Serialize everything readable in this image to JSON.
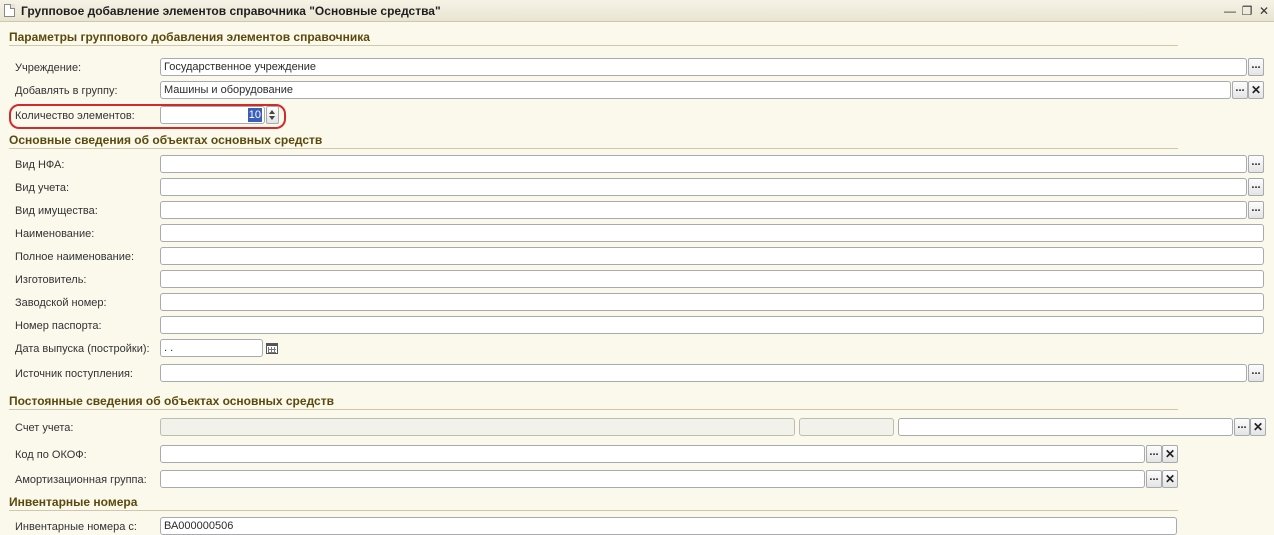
{
  "window": {
    "title": "Групповое добавление элементов справочника \"Основные средства\"",
    "minimize_icon": "minimize-icon",
    "restore_icon": "restore-icon",
    "close_icon": "close-icon"
  },
  "sections": {
    "group_params": "Параметры группового добавления элементов справочника",
    "basic_info": "Основные сведения об объектах основных средств",
    "constant_info": "Постоянные сведения об объектах основных средств",
    "inventory": "Инвентарные номера"
  },
  "fields": {
    "institution": {
      "label": "Учреждение:",
      "value": "Государственное учреждение"
    },
    "add_to_group": {
      "label": "Добавлять в группу:",
      "value": "Машины и оборудование"
    },
    "count": {
      "label": "Количество элементов:",
      "value": "10"
    },
    "nfa_type": {
      "label": "Вид НФА:",
      "value": ""
    },
    "accounting_type": {
      "label": "Вид учета:",
      "value": ""
    },
    "property_type": {
      "label": "Вид имущества:",
      "value": ""
    },
    "name": {
      "label": "Наименование:",
      "value": ""
    },
    "full_name": {
      "label": "Полное наименование:",
      "value": ""
    },
    "manufacturer": {
      "label": "Изготовитель:",
      "value": ""
    },
    "serial_number": {
      "label": "Заводской номер:",
      "value": ""
    },
    "passport_number": {
      "label": "Номер паспорта:",
      "value": ""
    },
    "release_date": {
      "label": "Дата выпуска (постройки):",
      "value": " .  ."
    },
    "source": {
      "label": "Источник поступления:",
      "value": ""
    },
    "account": {
      "label": "Счет учета:",
      "value": ""
    },
    "okof": {
      "label": "Код по ОКОФ:",
      "value": ""
    },
    "depreciation_group": {
      "label": "Амортизационная группа:",
      "value": ""
    },
    "inventory_from": {
      "label": "Инвентарные номера с:",
      "value": "ВА000000506"
    }
  },
  "buttons": {
    "select": "...",
    "clear": "✕"
  },
  "colors": {
    "background": "#fbf8ec",
    "section_text": "#5a4a0c",
    "highlight": "#d22a2a",
    "selection": "#3b5fb6"
  }
}
